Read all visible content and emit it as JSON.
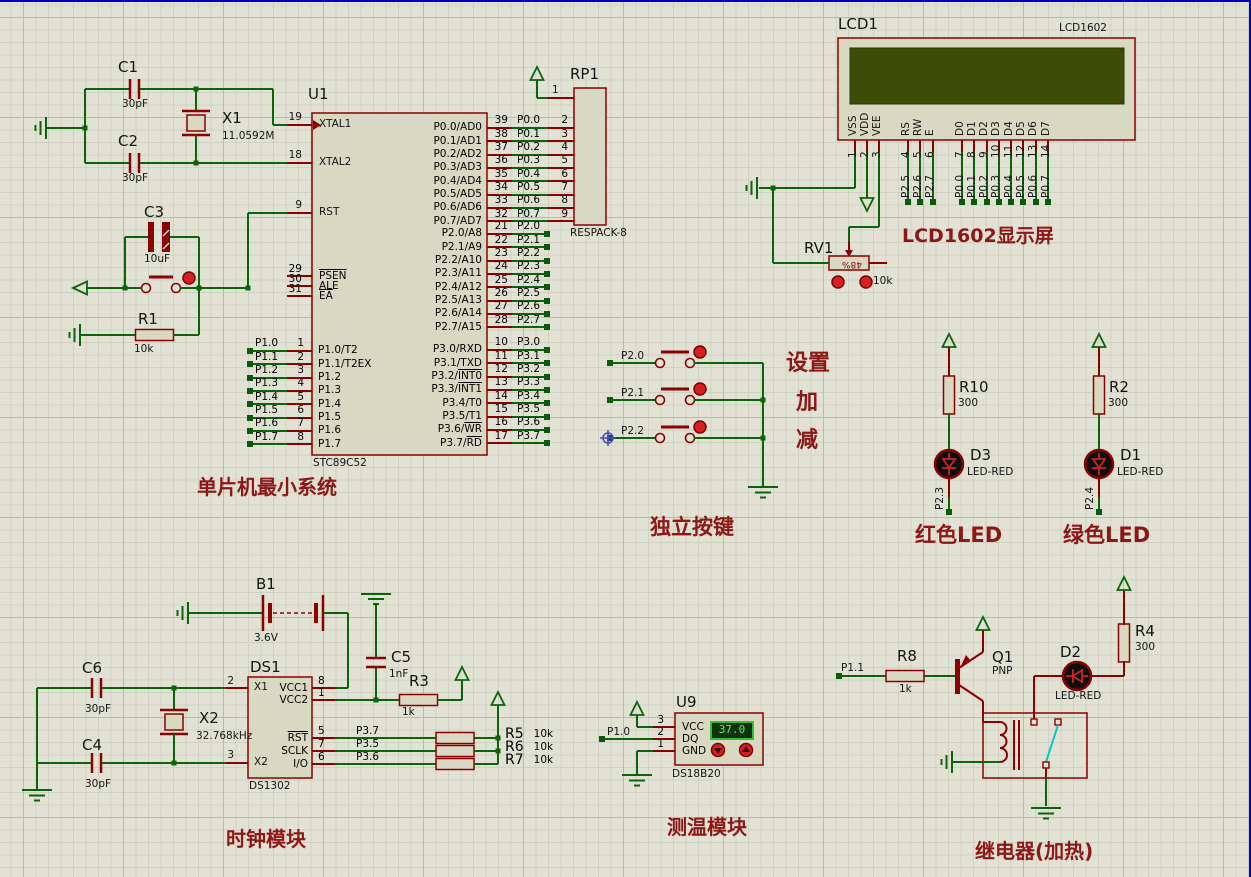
{
  "titles": {
    "mcu": "单片机最小系统",
    "keys": "独立按键",
    "lcd": "LCD1602显示屏",
    "red_led": "红色LED",
    "green_led": "绿色LED",
    "clock": "时钟模块",
    "temp": "测温模块",
    "relay": "继电器(加热)"
  },
  "key_labels": {
    "set": "设置",
    "inc": "加",
    "dec": "减"
  },
  "u1": {
    "ref": "U1",
    "part": "STC89C52",
    "xtal1": {
      "num": "19",
      "name": "XTAL1"
    },
    "xtal2": {
      "num": "18",
      "name": "XTAL2"
    },
    "rst": {
      "num": "9",
      "name": "RST"
    },
    "ctrl": [
      {
        "num": "29",
        "pre": "",
        "ov": "PSEN"
      },
      {
        "num": "30",
        "pre": "ALE",
        "ov": ""
      },
      {
        "num": "31",
        "pre": "",
        "ov": "EA"
      }
    ],
    "p1": [
      {
        "num": "1",
        "pre": "P1.0/T2",
        "net": "P1.0"
      },
      {
        "num": "2",
        "pre": "P1.1/T2EX",
        "net": "P1.1"
      },
      {
        "num": "3",
        "pre": "P1.2",
        "net": "P1.2"
      },
      {
        "num": "4",
        "pre": "P1.3",
        "net": "P1.3"
      },
      {
        "num": "5",
        "pre": "P1.4",
        "net": "P1.4"
      },
      {
        "num": "6",
        "pre": "P1.5",
        "net": "P1.5"
      },
      {
        "num": "7",
        "pre": "P1.6",
        "net": "P1.6"
      },
      {
        "num": "8",
        "pre": "P1.7",
        "net": "P1.7"
      }
    ],
    "p0": [
      {
        "num": "39",
        "pre": "P0.0/AD0",
        "net": "P0.0",
        "rp": "2"
      },
      {
        "num": "38",
        "pre": "P0.1/AD1",
        "net": "P0.1",
        "rp": "3"
      },
      {
        "num": "37",
        "pre": "P0.2/AD2",
        "net": "P0.2",
        "rp": "4"
      },
      {
        "num": "36",
        "pre": "P0.3/AD3",
        "net": "P0.3",
        "rp": "5"
      },
      {
        "num": "35",
        "pre": "P0.4/AD4",
        "net": "P0.4",
        "rp": "6"
      },
      {
        "num": "34",
        "pre": "P0.5/AD5",
        "net": "P0.5",
        "rp": "7"
      },
      {
        "num": "33",
        "pre": "P0.6/AD6",
        "net": "P0.6",
        "rp": "8"
      },
      {
        "num": "32",
        "pre": "P0.7/AD7",
        "net": "P0.7",
        "rp": "9"
      }
    ],
    "p2": [
      {
        "num": "21",
        "pre": "P2.0/A8",
        "net": "P2.0"
      },
      {
        "num": "22",
        "pre": "P2.1/A9",
        "net": "P2.1"
      },
      {
        "num": "23",
        "pre": "P2.2/A10",
        "net": "P2.2"
      },
      {
        "num": "24",
        "pre": "P2.3/A11",
        "net": "P2.3"
      },
      {
        "num": "25",
        "pre": "P2.4/A12",
        "net": "P2.4"
      },
      {
        "num": "26",
        "pre": "P2.5/A13",
        "net": "P2.5"
      },
      {
        "num": "27",
        "pre": "P2.6/A14",
        "net": "P2.6"
      },
      {
        "num": "28",
        "pre": "P2.7/A15",
        "net": "P2.7"
      }
    ],
    "p3": [
      {
        "num": "10",
        "pre": "P3.0/RXD",
        "ov": "",
        "net": "P3.0"
      },
      {
        "num": "11",
        "pre": "P3.1/TXD",
        "ov": "",
        "net": "P3.1"
      },
      {
        "num": "12",
        "pre": "P3.2/",
        "ov": "INT0",
        "net": "P3.2"
      },
      {
        "num": "13",
        "pre": "P3.3/",
        "ov": "INT1",
        "net": "P3.3"
      },
      {
        "num": "14",
        "pre": "P3.4/T0",
        "ov": "",
        "net": "P3.4"
      },
      {
        "num": "15",
        "pre": "P3.5/T1",
        "ov": "",
        "net": "P3.5"
      },
      {
        "num": "16",
        "pre": "P3.6/",
        "ov": "WR",
        "net": "P3.6"
      },
      {
        "num": "17",
        "pre": "P3.7/",
        "ov": "RD",
        "net": "P3.7"
      }
    ]
  },
  "rp1": {
    "ref": "RP1",
    "part": "RESPACK-8",
    "pin1": "1"
  },
  "xtal_sec": {
    "c1": {
      "ref": "C1",
      "val": "30pF"
    },
    "c2": {
      "ref": "C2",
      "val": "30pF"
    },
    "x1": {
      "ref": "X1",
      "val": "11.0592M"
    },
    "c3": {
      "ref": "C3",
      "val": "10uF"
    },
    "r1": {
      "ref": "R1",
      "val": "10k"
    }
  },
  "lcd": {
    "ref": "LCD1",
    "part": "LCD1602",
    "power_pins": [
      {
        "name": "VSS",
        "num": "1",
        "net": ""
      },
      {
        "name": "VDD",
        "num": "2",
        "net": ""
      },
      {
        "name": "VEE",
        "num": "3",
        "net": ""
      }
    ],
    "ctrl_pins": [
      {
        "name": "RS",
        "num": "4",
        "net": "P2.5"
      },
      {
        "name": "RW",
        "num": "5",
        "net": "P2.6"
      },
      {
        "name": "E",
        "num": "6",
        "net": "P2.7"
      }
    ],
    "data_pins": [
      {
        "name": "D0",
        "num": "7",
        "net": "P0.0"
      },
      {
        "name": "D1",
        "num": "8",
        "net": "P0.1"
      },
      {
        "name": "D2",
        "num": "9",
        "net": "P0.2"
      },
      {
        "name": "D3",
        "num": "10",
        "net": "P0.3"
      },
      {
        "name": "D4",
        "num": "11",
        "net": "P0.4"
      },
      {
        "name": "D5",
        "num": "12",
        "net": "P0.5"
      },
      {
        "name": "D6",
        "num": "13",
        "net": "P0.6"
      },
      {
        "name": "D7",
        "num": "14",
        "net": "P0.7"
      }
    ]
  },
  "rv1": {
    "ref": "RV1",
    "value": "10k",
    "pct": "48%"
  },
  "keys": {
    "nets": [
      {
        "net": "P2.0"
      },
      {
        "net": "P2.1"
      },
      {
        "net": "P2.2"
      }
    ]
  },
  "leds": {
    "red": {
      "r_ref": "R10",
      "r_val": "300",
      "d_ref": "D3",
      "d_val": "LED-RED",
      "net": "P2.3"
    },
    "green": {
      "r_ref": "R2",
      "r_val": "300",
      "d_ref": "D1",
      "d_val": "LED-RED",
      "net": "P2.4"
    }
  },
  "clock": {
    "b1": {
      "ref": "B1",
      "val": "3.6V"
    },
    "c6": {
      "ref": "C6",
      "val": "30pF"
    },
    "c4": {
      "ref": "C4",
      "val": "30pF"
    },
    "x2": {
      "ref": "X2",
      "val": "32.768kHz"
    },
    "c5": {
      "ref": "C5",
      "val": "1nF"
    },
    "r3": {
      "ref": "R3",
      "val": "1k"
    },
    "ds1": {
      "ref": "DS1",
      "part": "DS1302",
      "left": [
        {
          "num": "2",
          "name": "X1"
        },
        {
          "num": "3",
          "name": "X2"
        }
      ],
      "right_top": [
        {
          "num": "8",
          "pre": "VCC1",
          "ov": ""
        },
        {
          "num": "1",
          "pre": "VCC2",
          "ov": ""
        }
      ],
      "right_bot": [
        {
          "num": "5",
          "pre": "",
          "ov": "RST",
          "net": "P3.7"
        },
        {
          "num": "7",
          "pre": "SCLK",
          "ov": "",
          "net": "P3.5"
        },
        {
          "num": "6",
          "pre": "I/O",
          "ov": "",
          "net": "P3.6"
        }
      ]
    },
    "pulls": [
      {
        "ref": "R5",
        "val": "10k"
      },
      {
        "ref": "R6",
        "val": "10k"
      },
      {
        "ref": "R7",
        "val": "10k"
      }
    ]
  },
  "temp": {
    "ref": "U9",
    "part": "DS18B20",
    "net": "P1.0",
    "reading": "37.0",
    "pins": [
      {
        "num": "3",
        "name": "VCC"
      },
      {
        "num": "2",
        "name": "DQ"
      },
      {
        "num": "1",
        "name": "GND"
      }
    ]
  },
  "relay": {
    "net": "P1.1",
    "r8": {
      "ref": "R8",
      "val": "1k"
    },
    "q1": {
      "ref": "Q1",
      "val": "PNP"
    },
    "d2": {
      "ref": "D2",
      "val": "LED-RED"
    },
    "r4": {
      "ref": "R4",
      "val": "300"
    }
  }
}
